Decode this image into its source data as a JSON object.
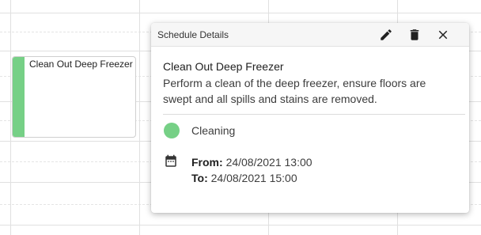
{
  "calendar": {
    "event": {
      "title": "Clean Out Deep Freezer",
      "color": "#76d086"
    }
  },
  "popup": {
    "header_title": "Schedule Details",
    "actions": {
      "edit_icon": "pencil-icon",
      "delete_icon": "trash-icon",
      "close_icon": "close-icon"
    },
    "subject": "Clean Out Deep Freezer",
    "description": "Perform a clean of the deep freezer, ensure floors are swept and all spills and stains are removed.",
    "category": {
      "label": "Cleaning",
      "color": "#76d086"
    },
    "time": {
      "icon": "calendar-icon",
      "from_label": "From:",
      "from_value": "24/08/2021 13:00",
      "to_label": "To:",
      "to_value": "24/08/2021 15:00"
    }
  }
}
